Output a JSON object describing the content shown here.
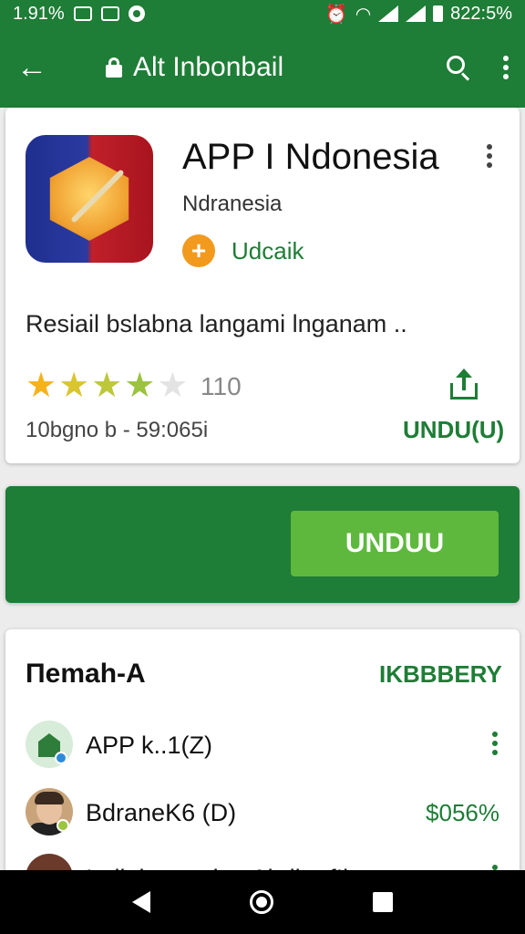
{
  "status_bar": {
    "left_text": "1.91%",
    "right_text": "822:5%"
  },
  "app_bar": {
    "title": "Alt Inbonbail",
    "back_icon": "arrow-back-icon",
    "lock_icon": "lock-icon",
    "search_icon": "search-icon",
    "more_icon": "more-vert-icon"
  },
  "app_card": {
    "name": "APP I Ndonesia",
    "developer": "Ndranesia",
    "badge_label": "Udcaik",
    "description": "Resiail bslabna langami lnganam ..",
    "rating": 4,
    "rating_count": "110",
    "meta": "10bgno b - 59:065i",
    "download_link": "UNDU(U)",
    "colors": {
      "accent": "#1e7d36",
      "badge": "#f29a1e",
      "star": "#f6b21a"
    }
  },
  "banner": {
    "install_label": "UNDUU",
    "colors": {
      "background": "#1e7d36",
      "button": "#5fb83e"
    }
  },
  "section": {
    "title": "Πemah-A",
    "more_label": "IKBBBERY",
    "rows": [
      {
        "name": "APP k..1(Z)",
        "trail": ""
      },
      {
        "name": "BdraneK6 (D)",
        "trail": "$056%"
      },
      {
        "name": "Indiakamuni ... Abdh...f!l",
        "trail": ""
      }
    ]
  },
  "nav_bar": {
    "back_icon": "nav-back-icon",
    "home_icon": "nav-home-icon",
    "recent_icon": "nav-recent-icon"
  }
}
